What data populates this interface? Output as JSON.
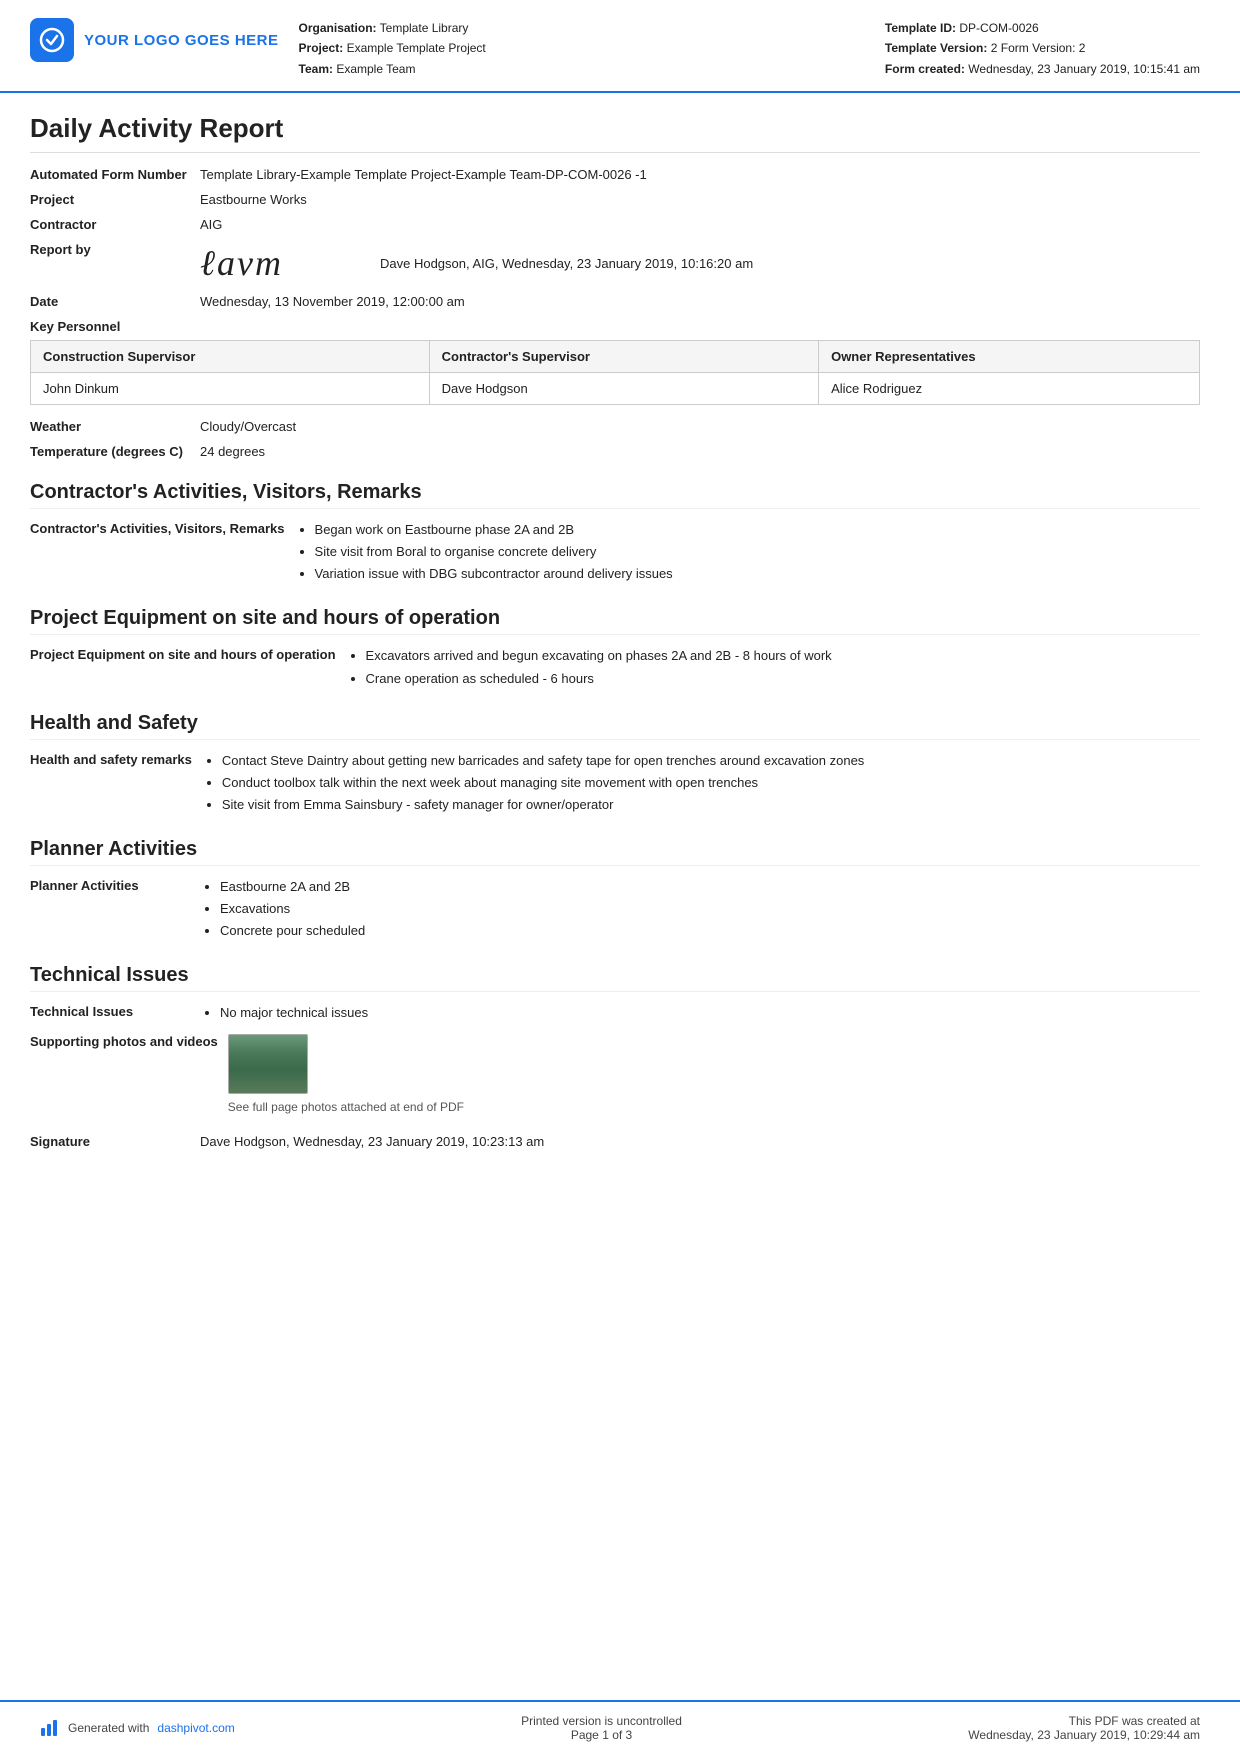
{
  "header": {
    "logo_text": "YOUR LOGO GOES HERE",
    "org_label": "Organisation:",
    "org_value": "Template Library",
    "project_label": "Project:",
    "project_value": "Example Template Project",
    "team_label": "Team:",
    "team_value": "Example Team",
    "template_id_label": "Template ID:",
    "template_id_value": "DP-COM-0026",
    "template_version_label": "Template Version:",
    "template_version_value": "2 Form Version: 2",
    "form_created_label": "Form created:",
    "form_created_value": "Wednesday, 23 January 2019, 10:15:41 am"
  },
  "report": {
    "title": "Daily Activity Report",
    "form_number_label": "Automated Form Number",
    "form_number_value": "Template Library-Example Template Project-Example Team-DP-COM-0026   -1",
    "project_label": "Project",
    "project_value": "Eastbourne Works",
    "contractor_label": "Contractor",
    "contractor_value": "AIG",
    "report_by_label": "Report by",
    "report_by_signature": "ℓavm",
    "report_by_value": "Dave Hodgson, AIG, Wednesday, 23 January 2019, 10:16:20 am",
    "date_label": "Date",
    "date_value": "Wednesday, 13 November 2019, 12:00:00 am"
  },
  "key_personnel": {
    "section_label": "Key Personnel",
    "columns": [
      "Construction Supervisor",
      "Contractor's Supervisor",
      "Owner Representatives"
    ],
    "rows": [
      [
        "John Dinkum",
        "Dave Hodgson",
        "Alice Rodriguez"
      ]
    ]
  },
  "weather": {
    "label": "Weather",
    "value": "Cloudy/Overcast",
    "temp_label": "Temperature (degrees C)",
    "temp_value": "24 degrees"
  },
  "contractors_activities": {
    "heading": "Contractor's Activities, Visitors, Remarks",
    "label": "Contractor's Activities, Visitors, Remarks",
    "items": [
      "Began work on Eastbourne phase 2A and 2B",
      "Site visit from Boral to organise concrete delivery",
      "Variation issue with DBG subcontractor around delivery issues"
    ]
  },
  "project_equipment": {
    "heading": "Project Equipment on site and hours of operation",
    "label": "Project Equipment on site and hours of operation",
    "items": [
      "Excavators arrived and begun excavating on phases 2A and 2B - 8 hours of work",
      "Crane operation as scheduled - 6 hours"
    ]
  },
  "health_safety": {
    "heading": "Health and Safety",
    "label": "Health and safety remarks",
    "items": [
      "Contact Steve Daintry about getting new barricades and safety tape for open trenches around excavation zones",
      "Conduct toolbox talk within the next week about managing site movement with open trenches",
      "Site visit from Emma Sainsbury - safety manager for owner/operator"
    ]
  },
  "planner_activities": {
    "heading": "Planner Activities",
    "label": "Planner Activities",
    "items": [
      "Eastbourne 2A and 2B",
      "Excavations",
      "Concrete pour scheduled"
    ]
  },
  "technical_issues": {
    "heading": "Technical Issues",
    "label": "Technical Issues",
    "items": [
      "No major technical issues"
    ],
    "photos_label": "Supporting photos and videos",
    "photo_caption": "See full page photos attached at end of PDF",
    "signature_label": "Signature",
    "signature_value": "Dave Hodgson, Wednesday, 23 January 2019, 10:23:13 am"
  },
  "footer": {
    "generated_text": "Generated with ",
    "link_text": "dashpivot.com",
    "center_line1": "Printed version is uncontrolled",
    "center_line2": "Page 1 of 3",
    "right_line1": "This PDF was created at",
    "right_line2": "Wednesday, 23 January 2019, 10:29:44 am"
  }
}
